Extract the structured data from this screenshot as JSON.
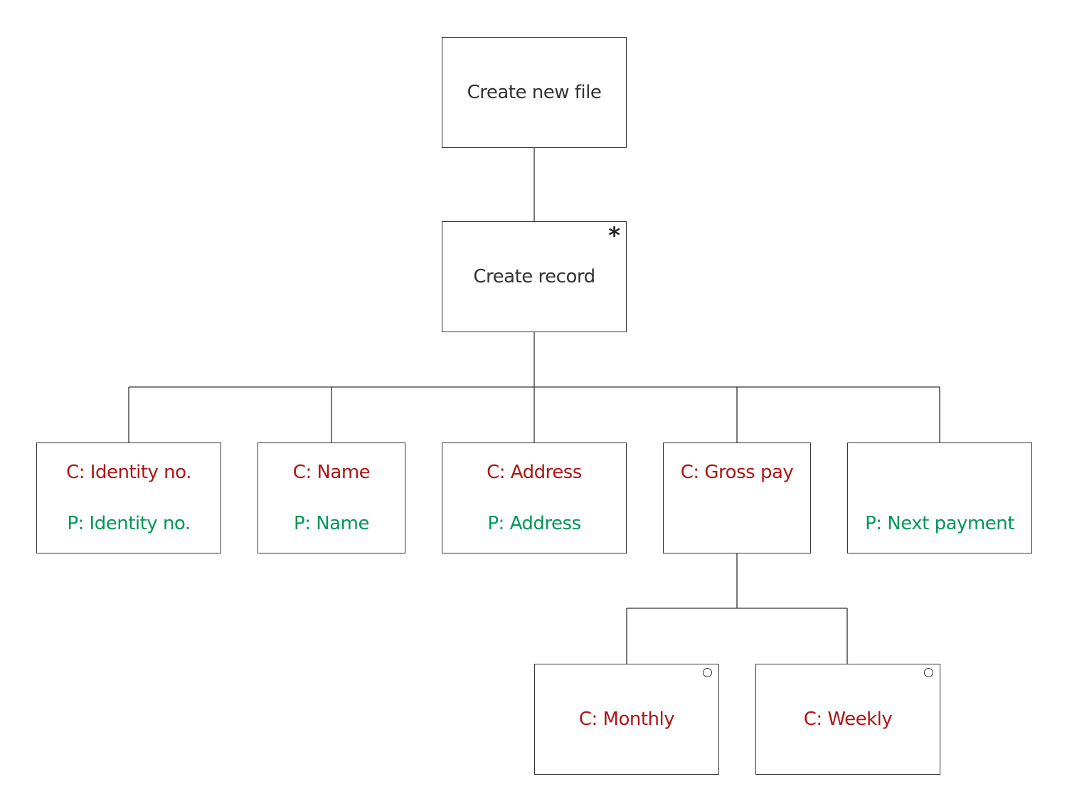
{
  "root": {
    "label": "Create new file"
  },
  "record": {
    "label": "Create record",
    "marker": "*"
  },
  "children": [
    {
      "component": "C: Identity no.",
      "process": "P: Identity no."
    },
    {
      "component": "C: Name",
      "process": "P: Name"
    },
    {
      "component": "C: Address",
      "process": "P: Address"
    },
    {
      "component": "C: Gross pay",
      "process": ""
    },
    {
      "component": "",
      "process": "P: Next payment"
    }
  ],
  "gross_pay_options": [
    {
      "component": "C: Monthly",
      "marker": "selection"
    },
    {
      "component": "C: Weekly",
      "marker": "selection"
    }
  ],
  "colors": {
    "component": "#b01414",
    "process": "#00965a",
    "text": "#333333"
  }
}
